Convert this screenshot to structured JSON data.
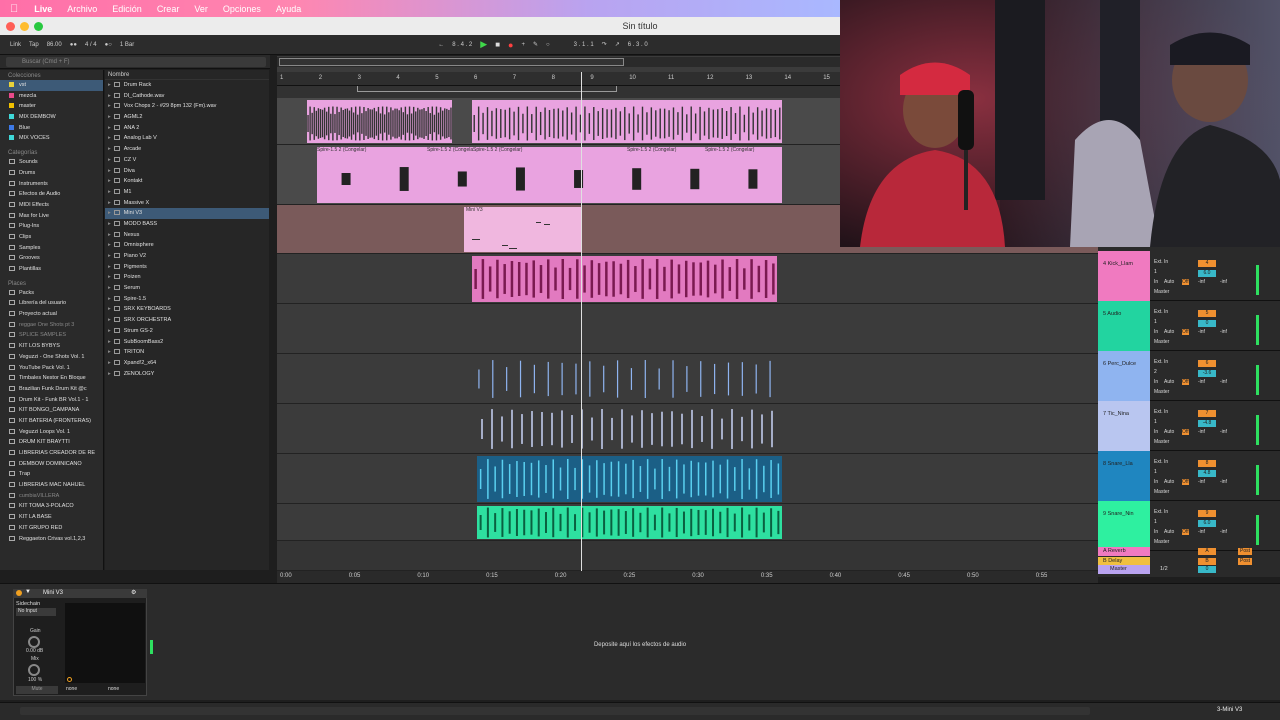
{
  "menubar": {
    "app": "Live",
    "items": [
      "Archivo",
      "Edición",
      "Crear",
      "Ver",
      "Opciones",
      "Ayuda"
    ]
  },
  "window": {
    "title": "Sin título"
  },
  "transport": {
    "link": "Link",
    "tap": "Tap",
    "tempo": "86.00",
    "signature": "4 / 4",
    "quantize": "1 Bar",
    "position": "8 . 4 . 2",
    "loop_start": "3 . 1 . 1",
    "loop_length": "6 . 3 . 0"
  },
  "browser": {
    "search_placeholder": "Buscar (Cmd + F)",
    "collections_title": "Colecciones",
    "collections": [
      {
        "label": "vst",
        "color": "#e8d23a"
      },
      {
        "label": "mezcla",
        "color": "#e84a8a"
      },
      {
        "label": "master",
        "color": "#f0c000"
      },
      {
        "label": "MIX DEMBOW",
        "color": "#3fd8d8"
      },
      {
        "label": "Blue",
        "color": "#3d7ae8"
      },
      {
        "label": "MIX VOCES",
        "color": "#3fd8d8"
      }
    ],
    "categories_title": "Categorías",
    "categories": [
      "Sounds",
      "Drums",
      "Instruments",
      "Efectos de Audio",
      "MIDI Effects",
      "Max for Live",
      "Plug-Ins",
      "Clips",
      "Samples",
      "Grooves",
      "Plantillas"
    ],
    "places_title": "Places",
    "places": [
      "Packs",
      "Librería del usuario",
      "Proyecto actual",
      "reggae One Shots pt 3",
      "SPLICE SAMPLES",
      "KIT LOS BYBYS",
      "Veguzzi - One Shots Vol. 1",
      "YouTube Pack Vol. 1",
      "Timbales Nestor En Bloque",
      "Brazilian Funk Drum Kit @c",
      "Drum Kit - Funk BR Vol.1 - 1",
      "KIT BONGO_CAMPANA",
      "KIT BATERIA (FRONTERAS)",
      "Veguzzi Loops Vol. 1",
      "DRUM KIT BRAYTTI",
      "LIBRERIAS CREADOR DE RE",
      "DEMBOW DOMINICANO",
      "Trap",
      "LIBRERIAS MAC NAHUEL",
      "cumbiaVILLERA",
      "KIT TOMA 3-POLACO",
      "KIT LA BASE",
      "KIT GRUPO RED",
      "Reggaeton Crivas vol.1,2,3"
    ],
    "column_header": "Nombre",
    "items": [
      "Drum Rack",
      "DI_Cathode.wav",
      "Vox Chops 2 - #29 8pm 132 (Fm).wav",
      "AGML2",
      "ANA 2",
      "Analog Lab V",
      "Arcade",
      "CZ V",
      "Diva",
      "Kontakt",
      "M1",
      "Massive X",
      "Mini V3",
      "MODO BASS",
      "Nexus",
      "Omnisphere",
      "Piano V2",
      "Pigments",
      "Poizen",
      "Serum",
      "Spire-1.5",
      "SRX KEYBOARDS",
      "SRX ORCHESTRA",
      "Strum GS-2",
      "SubBoomBass2",
      "TRITON",
      "Xpand!2_x64",
      "ZENOLOGY"
    ]
  },
  "ruler": [
    "1",
    "2",
    "3",
    "4",
    "5",
    "6",
    "7",
    "8",
    "9",
    "10",
    "11",
    "12",
    "13",
    "14",
    "15"
  ],
  "timeline": [
    "0:00",
    "0:05",
    "0:10",
    "0:15",
    "0:20",
    "0:25",
    "0:30",
    "0:35",
    "0:40",
    "0:45",
    "0:50",
    "0:55"
  ],
  "clips": {
    "spire_label": "Spire-1.5 2 (Congelar)",
    "spire_short": "Spire-1.5 2 (Congela",
    "minimoog_label": "Mini V3"
  },
  "mixer": {
    "tracks": [
      {
        "name": "4 Kick_Llam",
        "color": "#f07ac0",
        "input": "Ext. In",
        "channel": "1",
        "num": "4",
        "vol": "6.0"
      },
      {
        "name": "5 Audio",
        "color": "#22d4a0",
        "input": "Ext. In",
        "channel": "1",
        "num": "5",
        "vol": "0"
      },
      {
        "name": "6 Perc_Dulce",
        "color": "#8fb4f0",
        "input": "Ext. In",
        "channel": "2",
        "num": "6",
        "vol": "-3.6"
      },
      {
        "name": "7 Tic_Nina",
        "color": "#b9c6f0",
        "input": "Ext. In",
        "channel": "1",
        "num": "7",
        "vol": "-4.8"
      },
      {
        "name": "8 Snare_Lla",
        "color": "#1f86c0",
        "input": "Ext. In",
        "channel": "1",
        "num": "8",
        "vol": "4.8"
      },
      {
        "name": "9 Snare_Nin",
        "color": "#2ef0a0",
        "input": "Ext. In",
        "channel": "1",
        "num": "9",
        "vol": "6.0"
      }
    ],
    "monitor": "Auto",
    "in_label": "In",
    "off_label": "Off",
    "output": "Master",
    "inf": "-inf",
    "returns": [
      {
        "name": "A Reverb",
        "color": "#f07ac0",
        "letter": "A",
        "tag": "Post"
      },
      {
        "name": "B Delay",
        "color": "#f0c040",
        "letter": "B",
        "tag": "Post"
      }
    ],
    "master": {
      "name": "Master",
      "color": "#b9a3f0",
      "cue": "1/2",
      "num": "0"
    }
  },
  "device": {
    "name": "Mini V3",
    "sidechain": "Sidechain",
    "input": "No Input",
    "gain_label": "Gain",
    "gain_value": "0.00 dB",
    "mix_label": "Mix",
    "mix_value": "100 %",
    "mute": "Mute",
    "none1": "none",
    "none2": "none",
    "drop_hint": "Deposite aquí los efectos de audio"
  },
  "status": {
    "selected": "3-Mini V3"
  }
}
